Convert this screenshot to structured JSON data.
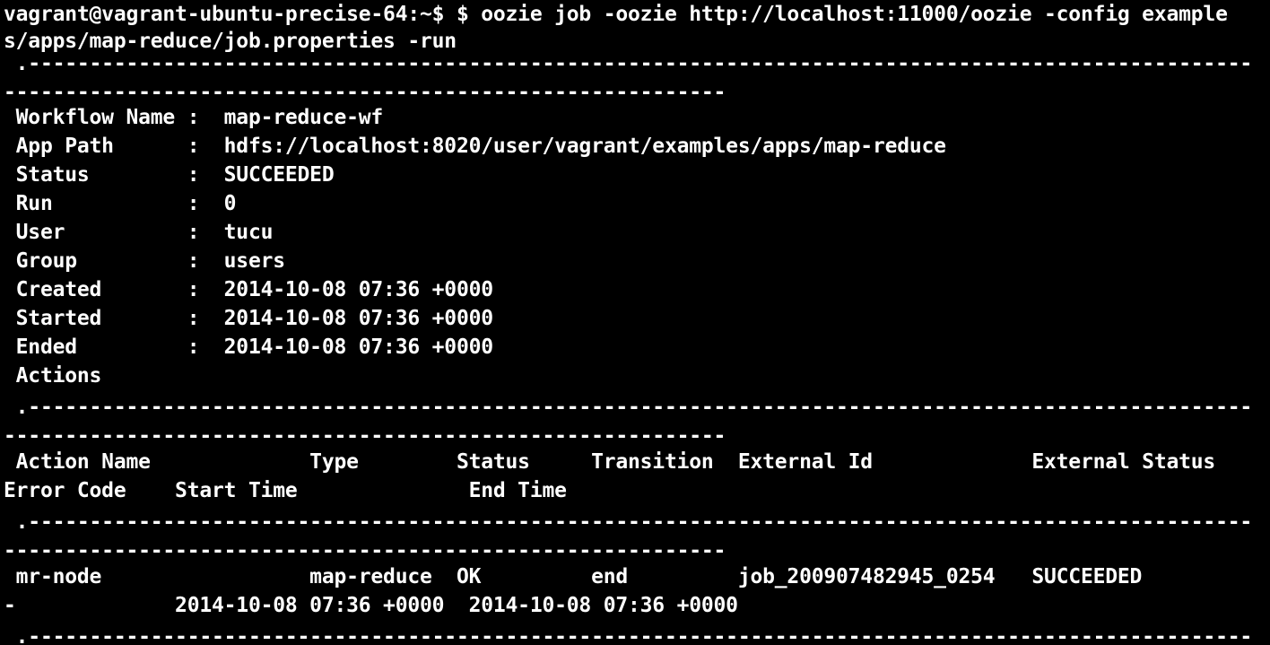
{
  "terminal": {
    "background": "#000000",
    "foreground": "#ffffff",
    "lines": [
      "vagrant@vagrant-ubuntu-precise-64:~$ $ oozie job -oozie http://localhost:11000/oozie -config example",
      "s/apps/map-reduce/job.properties -run",
      " .----------------------------------------------------------------------------------------------------",
      "-----------------------------------------------------------",
      " Workflow Name :  map-reduce-wf",
      " App Path      :  hdfs://localhost:8020/user/vagrant/examples/apps/map-reduce",
      " Status        :  SUCCEEDED",
      " Run           :  0",
      " User          :  tucu",
      " Group         :  users",
      " Created       :  2014-10-08 07:36 +0000",
      " Started       :  2014-10-08 07:36 +0000",
      " Ended         :  2014-10-08 07:36 +0000",
      " Actions",
      " .----------------------------------------------------------------------------------------------------",
      "-----------------------------------------------------------",
      " Action Name             Type        Status     Transition  External Id             External Status",
      "Error Code    Start Time              End Time",
      " .----------------------------------------------------------------------------------------------------",
      "-----------------------------------------------------------",
      " mr-node                 map-reduce  OK         end         job_200907482945_0254   SUCCEEDED",
      "-             2014-10-08 07:36 +0000  2014-10-08 07:36 +0000",
      " .----------------------------------------------------------------------------------------------------"
    ]
  }
}
